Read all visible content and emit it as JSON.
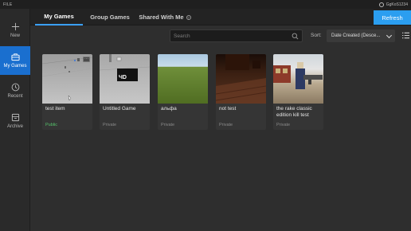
{
  "topbar": {
    "file": "FILE",
    "username": "GgKoS1234"
  },
  "sidebar": {
    "items": [
      {
        "label": "New",
        "icon": "plus-icon",
        "active": false
      },
      {
        "label": "My Games",
        "icon": "briefcase-icon",
        "active": true
      },
      {
        "label": "Recent",
        "icon": "clock-icon",
        "active": false
      },
      {
        "label": "Archive",
        "icon": "archive-icon",
        "active": false
      }
    ]
  },
  "tabs": [
    {
      "label": "My Games",
      "active": true
    },
    {
      "label": "Group Games",
      "active": false
    },
    {
      "label": "Shared With Me",
      "active": false,
      "help_icon": "question-icon"
    }
  ],
  "refresh_label": "Refresh",
  "search": {
    "placeholder": "Search",
    "icon": "search-icon"
  },
  "sort": {
    "label": "Sort:",
    "selected": "Date Created (Desce..."
  },
  "games": [
    {
      "title": "test item",
      "status": "Public"
    },
    {
      "title": "Untitled Game",
      "status": "Private"
    },
    {
      "title": "альфа",
      "status": "Private"
    },
    {
      "title": "not test",
      "status": "Private"
    },
    {
      "title": "the rake classic edition kill test",
      "status": "Private"
    }
  ],
  "colors": {
    "accent": "#1a6fcf",
    "refresh": "#2b9ef0",
    "public": "#55c36b",
    "tab_underline": "#3aa0ff"
  }
}
